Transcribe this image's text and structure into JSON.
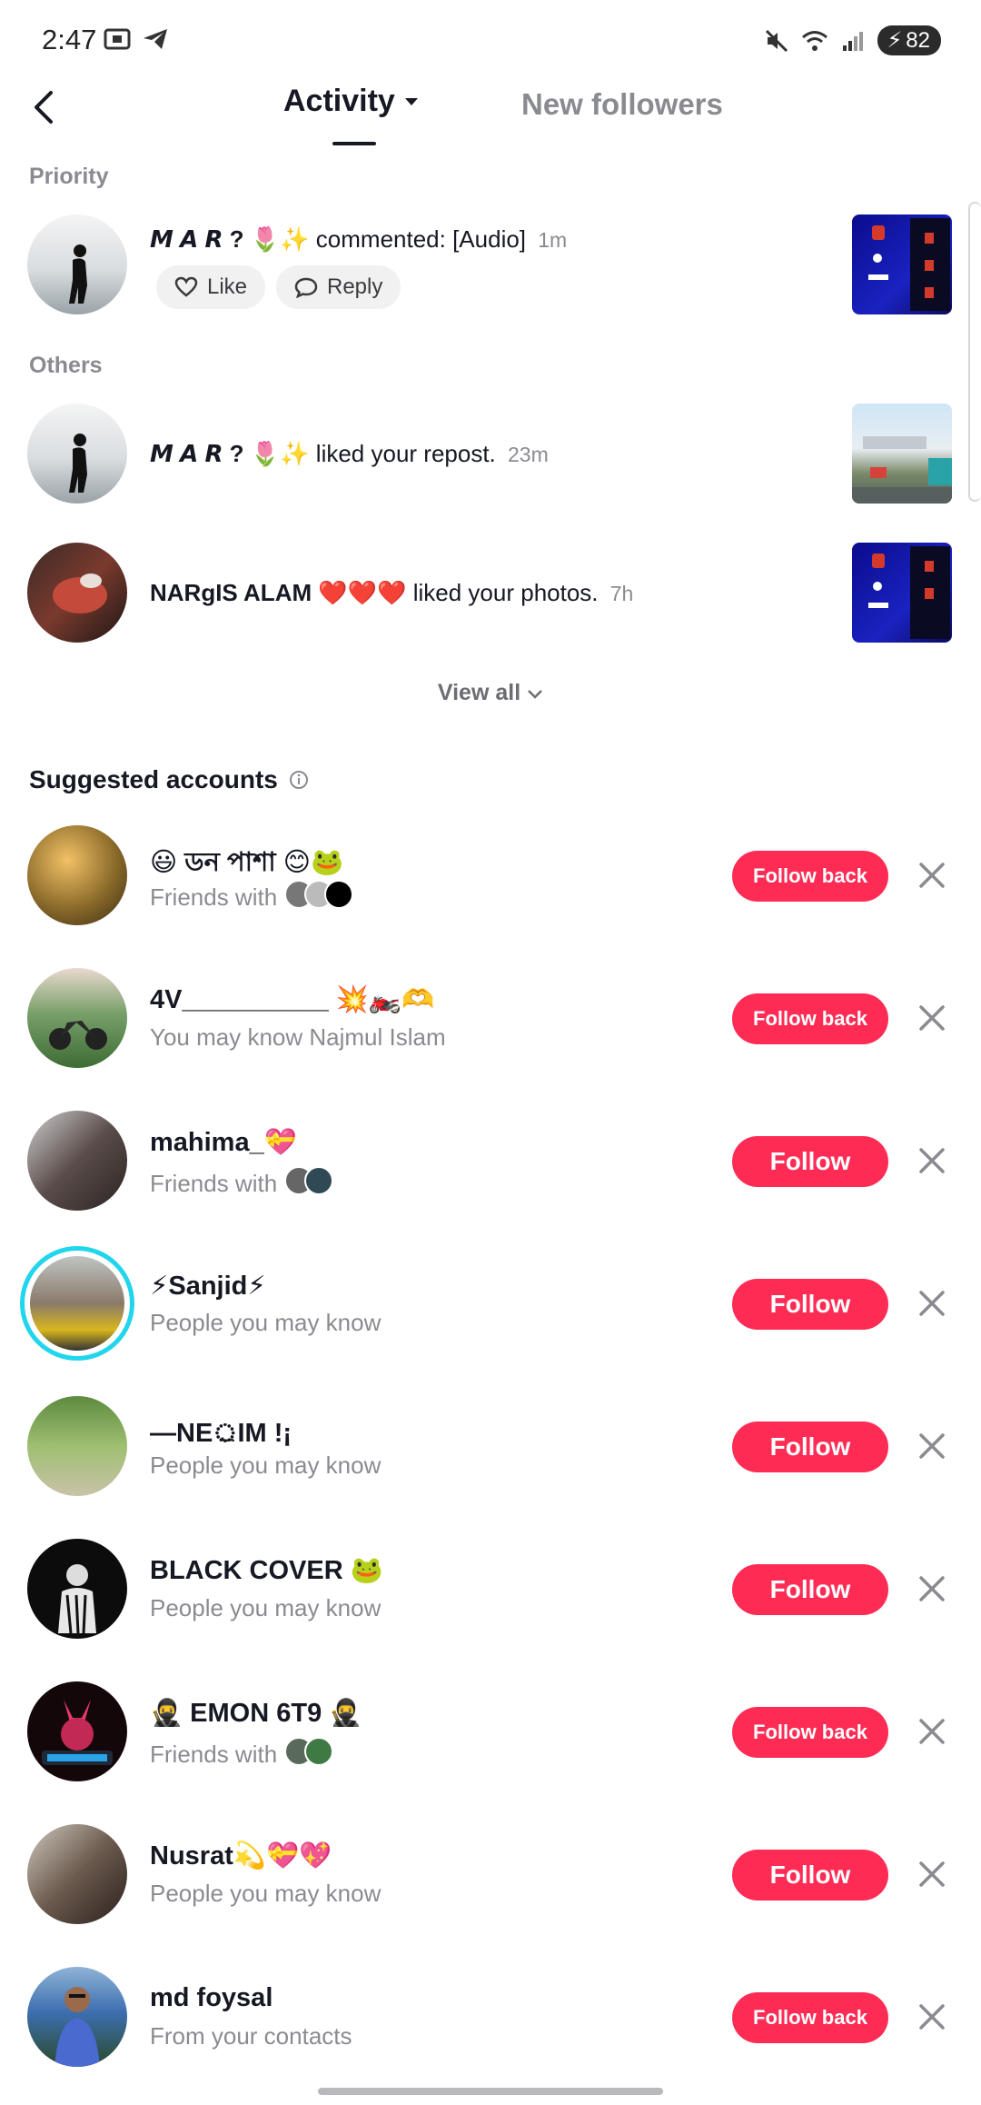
{
  "status": {
    "time": "2:47",
    "battery": "82"
  },
  "header": {
    "tab_activity": "Activity",
    "tab_followers": "New followers"
  },
  "sections": {
    "priority": "Priority",
    "others": "Others"
  },
  "notifications": [
    {
      "name": "𝙈 𝘼 𝙍 ?",
      "emoji": "🌷✨",
      "text": "commented: [Audio]",
      "time": "1m",
      "like": "Like",
      "reply": "Reply"
    },
    {
      "name": "𝙈 𝘼 𝙍 ?",
      "emoji": "🌷✨",
      "text": "liked your repost.",
      "time": "23m"
    },
    {
      "name": "NARgIS ALAM",
      "emoji": "❤️❤️❤️",
      "text": "liked your photos.",
      "time": "7h"
    }
  ],
  "view_all": "View all",
  "suggested": {
    "title": "Suggested accounts",
    "accounts": [
      {
        "name": "😃 ডন পাশা 😊🐸",
        "sub": "Friends with",
        "button": "Follow back"
      },
      {
        "name": "4V__________ 💥🏍️🫶",
        "sub": "You may know Najmul Islam",
        "button": "Follow back"
      },
      {
        "name": "mahima_💝",
        "sub": "Friends with",
        "button": "Follow"
      },
      {
        "name": "⚡Sanjid⚡",
        "sub": "People you may know",
        "button": "Follow"
      },
      {
        "name": "—NE্ৰIM !¡",
        "sub": "People you may know",
        "button": "Follow"
      },
      {
        "name": "BLACK COVER 🐸",
        "sub": "People you may know",
        "button": "Follow"
      },
      {
        "name": "🥷 EMON 6T9 🥷",
        "sub": "Friends with",
        "button": "Follow back"
      },
      {
        "name": "Nusrat💫💝💖",
        "sub": "People you may know",
        "button": "Follow"
      },
      {
        "name": "md foysal",
        "sub": "From your contacts",
        "button": "Follow back"
      }
    ]
  },
  "colors": {
    "accent": "#fe2c55",
    "muted": "#8a8b91",
    "text": "#161823"
  }
}
